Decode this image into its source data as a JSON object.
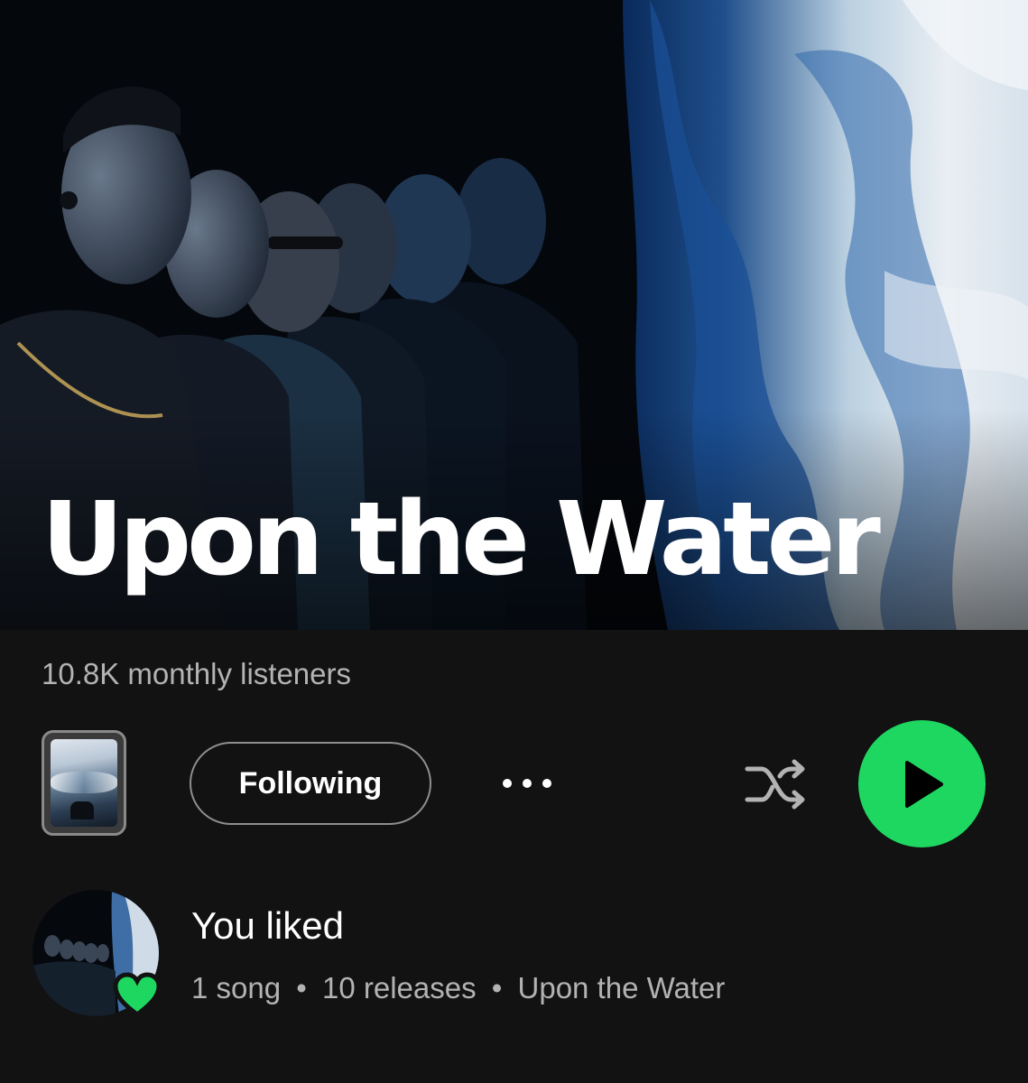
{
  "artist": {
    "name": "Upon the Water",
    "monthly_listeners": "10.8K monthly listeners"
  },
  "actions": {
    "follow_label": "Following",
    "more_label": "• • •"
  },
  "liked": {
    "title": "You liked",
    "songs": "1 song",
    "releases": "10 releases",
    "artist": "Upon the Water",
    "separator": "•"
  },
  "colors": {
    "accent": "#1ed760",
    "background": "#121212",
    "secondary_text": "#b3b3b3"
  },
  "icons": [
    "shuffle-icon",
    "play-icon",
    "heart-icon",
    "more-icon"
  ]
}
